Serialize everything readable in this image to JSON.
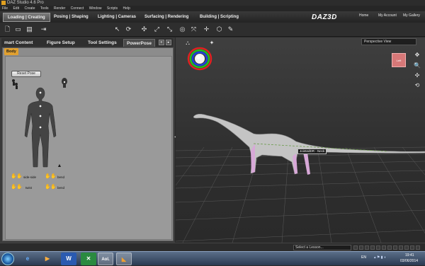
{
  "window": {
    "title": "DAZ Studio 4.6 Pro"
  },
  "menubar": {
    "items": [
      "File",
      "Edit",
      "Create",
      "Tools",
      "Render",
      "Connect",
      "Window",
      "Scripts",
      "Help"
    ]
  },
  "top_nav": {
    "tabs": [
      "Loading | Creating",
      "Posing | Shaping",
      "Lighting | Cameras",
      "Surfacing | Rendering",
      "Building | Scripting"
    ],
    "active_tab": "Loading | Creating",
    "logo": "DAZ3D",
    "links": [
      "Home",
      "My Account",
      "My Gallery"
    ]
  },
  "toolbar": {
    "icons": [
      "new-icon",
      "open-icon",
      "save-icon",
      "merge-icon",
      "select-icon",
      "orbit-icon",
      "universal-icon",
      "node-icon",
      "translate-icon",
      "rotate-icon",
      "scale-icon",
      "joint-editor-icon",
      "geometry-icon",
      "pin-icon"
    ]
  },
  "left_panel": {
    "tabs": [
      "mart Content",
      "Figure Setup",
      "Tool Settings",
      "PowerPose"
    ],
    "active_tab": "PowerPose",
    "body_tab": "Body",
    "reset_button": "Reset Pose",
    "labels": {
      "side_side": "side-side",
      "bend1": "bend",
      "twist": "twist",
      "bend2": "bend"
    }
  },
  "viewport": {
    "view_select": "Perspective View",
    "view_cube_label": "Left",
    "joint_tooltip": "JointedDR - Neck",
    "colors": {
      "dino_body": "#c8c8c8",
      "grid": "#6a6a6a",
      "joint_marker": "#d060d0"
    }
  },
  "bottom_bar": {
    "lesson_placeholder": "Select a Lesson..."
  },
  "taskbar": {
    "apps": [
      "start-orb",
      "ie-icon",
      "media-player-icon",
      "word-icon",
      "excel-icon",
      "aol-icon",
      "daz-studio-icon"
    ],
    "aol_label": "Aol.",
    "word_label": "W",
    "language": "EN",
    "time": "19:41",
    "date": "03/06/2014"
  }
}
